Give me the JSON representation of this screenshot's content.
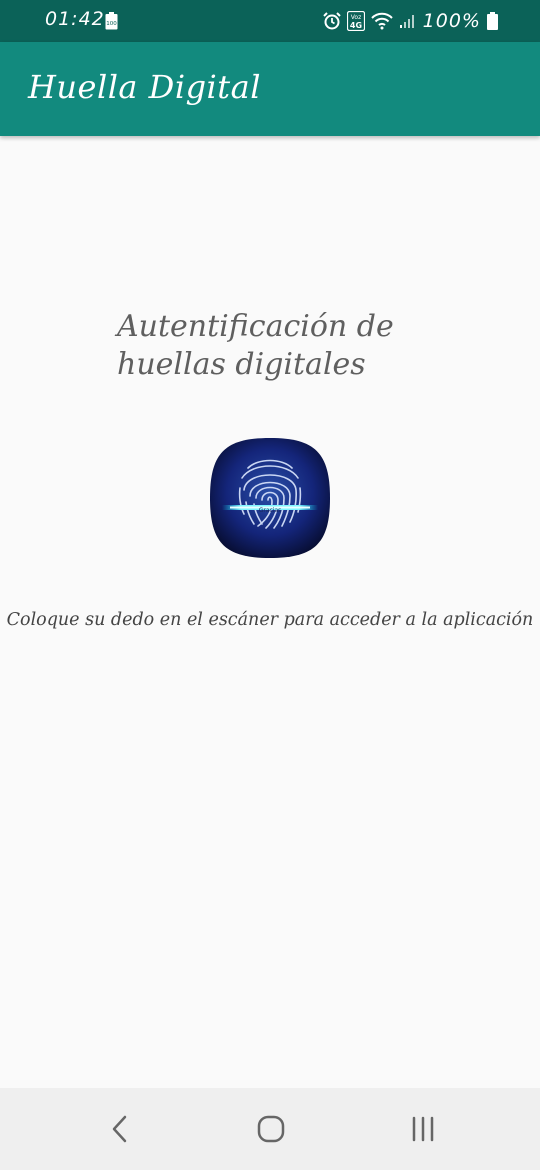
{
  "status_bar": {
    "time": "01:42",
    "notification_badge": "100",
    "battery_percent": "100%",
    "network_badge": "4G",
    "icons": [
      "alarm-icon",
      "volte-4g-icon",
      "wifi-icon",
      "signal-icon",
      "battery-icon"
    ]
  },
  "app_bar": {
    "title": "Huella Digital",
    "color": "#128a7e",
    "status_color": "#0b6258"
  },
  "main": {
    "heading": "Autentificación de huellas digitales",
    "image_caption": "Gracias",
    "instruction": "Coloque su dedo en el escáner para acceder a la aplicación"
  },
  "nav_bar": {
    "icons": [
      "back-icon",
      "home-icon",
      "recents-icon"
    ]
  }
}
